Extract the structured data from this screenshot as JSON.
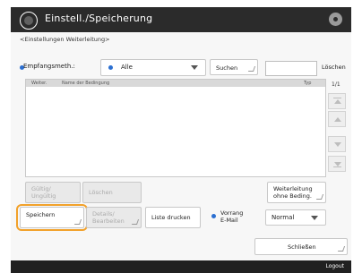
{
  "title": "Einstell./Speicherung",
  "breadcrumb": "<Einstellungen Weiterleitung>",
  "filter": {
    "label": "Empfangsmeth.:",
    "value": "Alle",
    "search_button": "Suchen",
    "clear_button": "Löschen"
  },
  "table": {
    "columns": [
      "Weiter.",
      "Name der Bedingung",
      "Typ"
    ],
    "page": "1/1"
  },
  "actions": {
    "enable_disable": "Gültig/\nUngültig",
    "delete": "Löschen",
    "forward_without_condition": "Weiterleitung\nohne Beding.",
    "save": "Speichern",
    "edit_details": "Details/\nBearbeiten",
    "print_list": "Liste drucken",
    "priority_label": "Vorrang\nE-Mail",
    "priority_value": "Normal",
    "close": "Schließen"
  },
  "footer": {
    "logout": "Logout"
  }
}
